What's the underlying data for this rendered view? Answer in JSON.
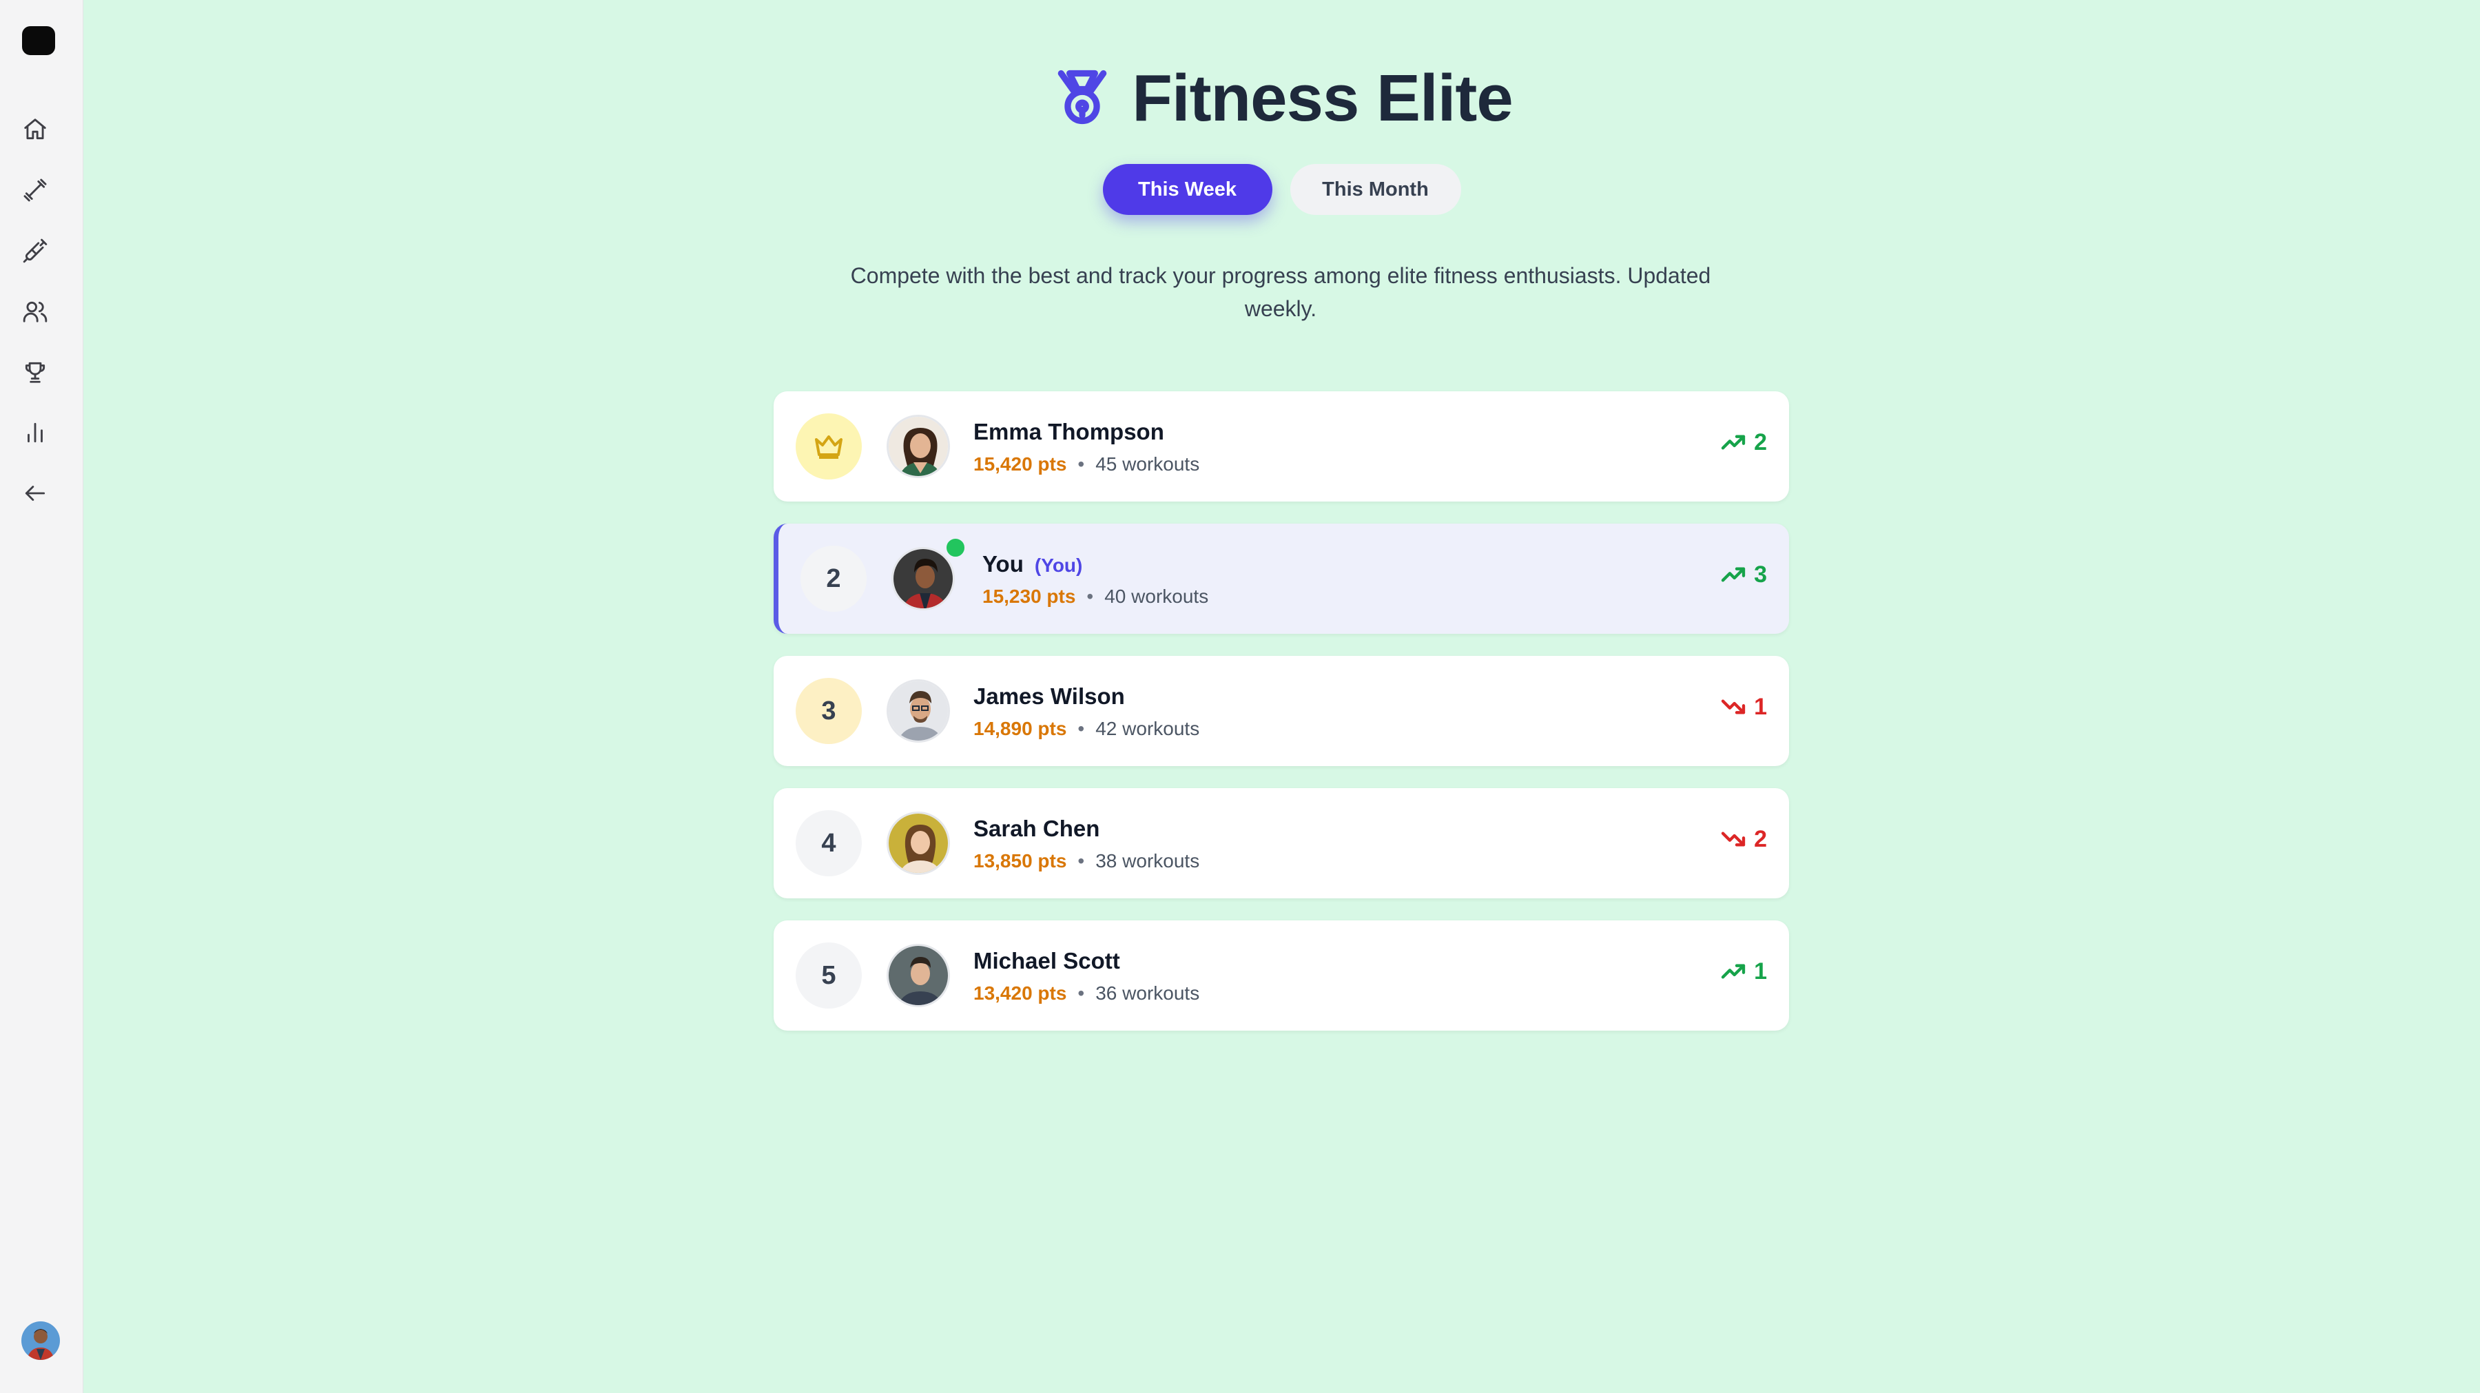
{
  "app": {
    "title": "Fitness Elite",
    "subtitle": "Compete with the best and track your progress among elite fitness enthusiasts. Updated weekly."
  },
  "sidebar": {
    "logo_icon": "app-logo",
    "items": [
      {
        "icon": "home-icon"
      },
      {
        "icon": "dumbbell-icon"
      },
      {
        "icon": "syringe-icon"
      },
      {
        "icon": "users-icon"
      },
      {
        "icon": "trophy-icon"
      },
      {
        "icon": "bar-chart-icon"
      },
      {
        "icon": "arrow-left-icon"
      }
    ],
    "user_avatar": "user-avatar"
  },
  "tabs": {
    "week": "This Week",
    "month": "This Month",
    "active": "This Week"
  },
  "leaderboard": [
    {
      "rank": "1",
      "rank_icon": "crown-icon",
      "name": "Emma Thompson",
      "you": "",
      "points": "15,420 pts",
      "workouts": "45 workouts",
      "trend": "up",
      "change": "2"
    },
    {
      "rank": "2",
      "name": "You",
      "you": "(You)",
      "points": "15,230 pts",
      "workouts": "40 workouts",
      "trend": "up",
      "change": "3"
    },
    {
      "rank": "3",
      "name": "James Wilson",
      "you": "",
      "points": "14,890 pts",
      "workouts": "42 workouts",
      "trend": "down",
      "change": "1"
    },
    {
      "rank": "4",
      "name": "Sarah Chen",
      "you": "",
      "points": "13,850 pts",
      "workouts": "38 workouts",
      "trend": "down",
      "change": "2"
    },
    {
      "rank": "5",
      "name": "Michael Scott",
      "you": "",
      "points": "13,420 pts",
      "workouts": "36 workouts",
      "trend": "up",
      "change": "1"
    }
  ],
  "separator": "•",
  "colors": {
    "background": "#d7f8e5",
    "accent": "#4f3ae8",
    "points": "#d97706",
    "trend_up": "#16a34a",
    "trend_down": "#dc2626"
  }
}
